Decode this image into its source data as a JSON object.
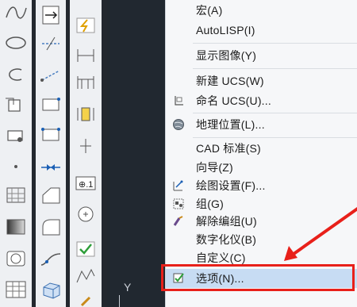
{
  "menu": {
    "items": [
      {
        "label": "宏(A)",
        "icon": "none"
      },
      {
        "label": "AutoLISP(I)",
        "icon": "none"
      },
      {
        "label": "显示图像(Y)",
        "icon": "none"
      },
      {
        "label": "新建 UCS(W)",
        "icon": "none"
      },
      {
        "label": "命名 UCS(U)...",
        "icon": "ucs-icon"
      },
      {
        "label": "地理位置(L)...",
        "icon": "globe-icon"
      },
      {
        "label": "CAD 标准(S)",
        "icon": "none"
      },
      {
        "label": "向导(Z)",
        "icon": "none"
      },
      {
        "label": "绘图设置(F)...",
        "icon": "drafting-settings-icon"
      },
      {
        "label": "组(G)",
        "icon": "group-icon"
      },
      {
        "label": "解除编组(U)",
        "icon": "ungroup-icon"
      },
      {
        "label": "数字化仪(B)",
        "icon": "none"
      },
      {
        "label": "自定义(C)",
        "icon": "none"
      },
      {
        "label": "选项(N)...",
        "icon": "options-icon"
      }
    ]
  },
  "canvas": {
    "axis_label": "Y"
  },
  "colors": {
    "highlight": "#c7dcf3",
    "annotation_red": "#e8201a",
    "canvas_bg": "#212830"
  }
}
